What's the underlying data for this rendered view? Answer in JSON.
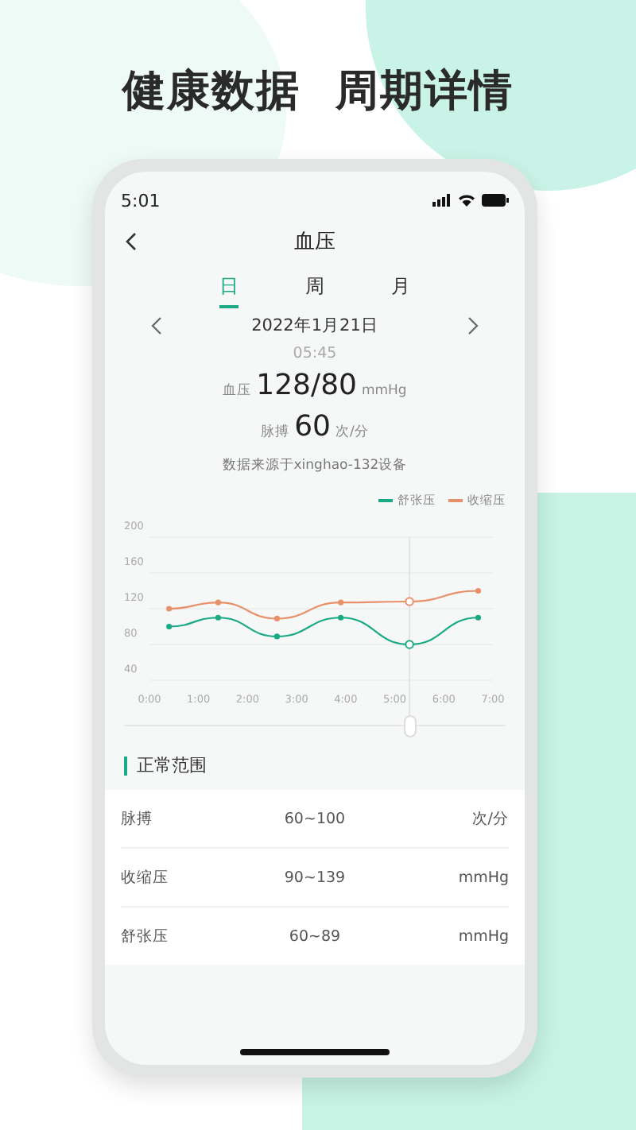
{
  "headline": [
    "健康数据",
    "周期详情"
  ],
  "status_bar": {
    "time": "5:01"
  },
  "nav": {
    "title": "血压"
  },
  "tabs": [
    {
      "label": "日",
      "selected": true
    },
    {
      "label": "周",
      "selected": false
    },
    {
      "label": "月",
      "selected": false
    }
  ],
  "date": "2022年1月21日",
  "time": "05:45",
  "reading": {
    "label": "血压",
    "value": "128/80",
    "unit": "mmHg"
  },
  "pulse": {
    "label": "脉搏",
    "value": "60",
    "unit": "次/分"
  },
  "source": "数据来源于xinghao-132设备",
  "chart_data": {
    "type": "line",
    "grid": true,
    "ref_lines": [
      {
        "axis": "x",
        "value": 5.3,
        "color": "#e3e5e5"
      }
    ],
    "x": [
      0.4,
      1.4,
      2.6,
      3.9,
      5.3,
      6.7
    ],
    "xlim": [
      0,
      7
    ],
    "ylim": [
      40,
      200
    ],
    "yticks": [
      40,
      80,
      120,
      160,
      200
    ],
    "xticks": [
      {
        "value": 0,
        "label": "0:00"
      },
      {
        "value": 1,
        "label": "1:00"
      },
      {
        "value": 2,
        "label": "2:00"
      },
      {
        "value": 3,
        "label": "3:00"
      },
      {
        "value": 4,
        "label": "4:00"
      },
      {
        "value": 5,
        "label": "5:00"
      },
      {
        "value": 6,
        "label": "6:00"
      },
      {
        "value": 7,
        "label": "7:00"
      }
    ],
    "series": [
      {
        "name": "舒张压",
        "color": "#1aaa85",
        "marker": "o",
        "values": [
          100,
          110,
          89,
          110,
          80,
          110
        ]
      },
      {
        "name": "收缩压",
        "color": "#e8906a",
        "marker": "o",
        "values": [
          120,
          127,
          109,
          127,
          128,
          140
        ]
      }
    ]
  },
  "scrubber": {
    "level": 0.757
  },
  "range": {
    "title": "正常范围",
    "rows": [
      {
        "name": "脉搏",
        "range": "60~100",
        "unit": "次/分"
      },
      {
        "name": "收缩压",
        "range": "90~139",
        "unit": "mmHg"
      },
      {
        "name": "舒张压",
        "range": "60~89",
        "unit": "mmHg"
      }
    ]
  }
}
